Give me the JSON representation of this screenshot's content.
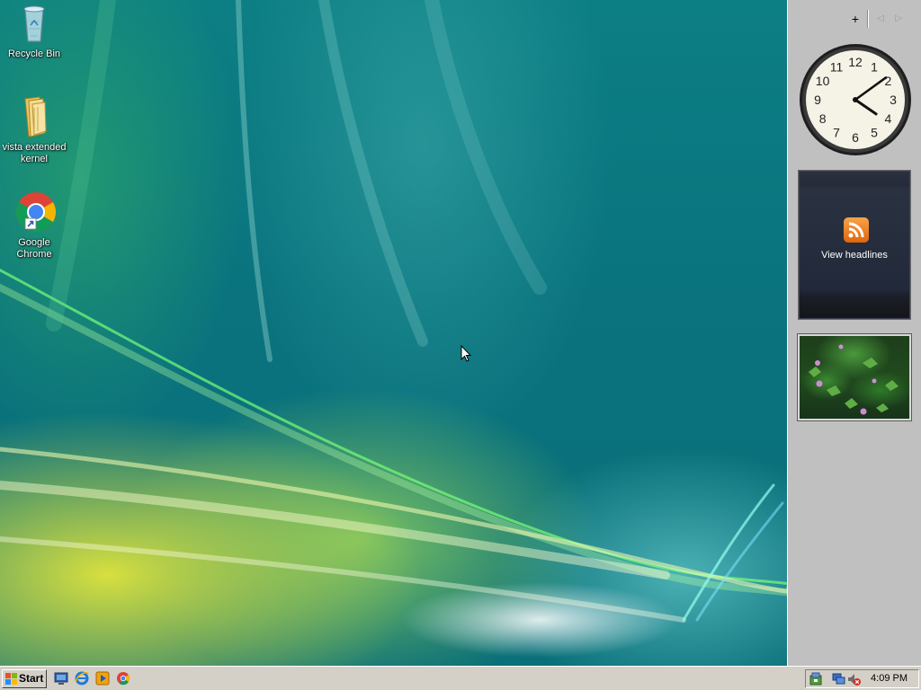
{
  "desktop": {
    "icons": [
      {
        "label": "Recycle Bin"
      },
      {
        "label": "vista extended kernel"
      },
      {
        "label": "Google Chrome"
      }
    ]
  },
  "sidebar": {
    "controls": {
      "add": "+",
      "prev": "◁",
      "next": "▷"
    },
    "clock": {
      "numerals": [
        "12",
        "1",
        "2",
        "3",
        "4",
        "5",
        "6",
        "7",
        "8",
        "9",
        "10",
        "11"
      ],
      "hour": 4,
      "minute": 9
    },
    "feed": {
      "label": "View headlines"
    }
  },
  "taskbar": {
    "start_label": "Start",
    "time": "4:09 PM"
  },
  "colors": {
    "taskbar": "#d4d0c8",
    "sidebar": "#c0c0c0",
    "rss": "#f08a24"
  }
}
